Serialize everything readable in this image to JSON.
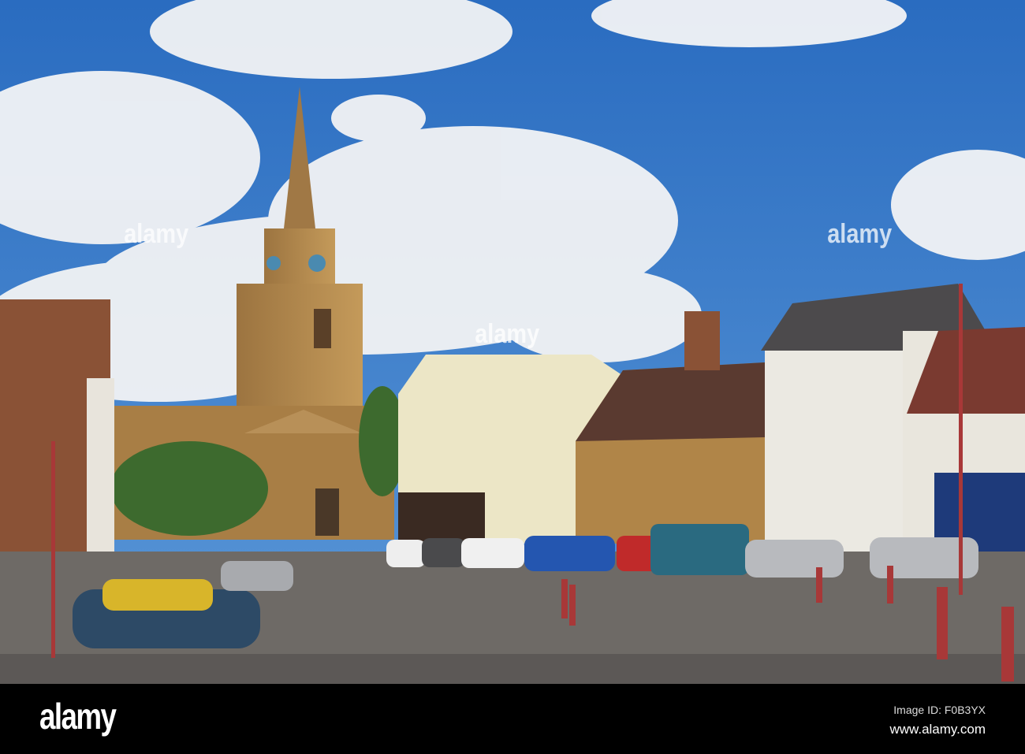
{
  "photo": {
    "subject": "town square with church spire"
  },
  "watermark": {
    "text": "alamy"
  },
  "footer": {
    "logo": "alamy",
    "image_id": "Image ID: F0B3YX",
    "website": "www.alamy.com"
  },
  "colors": {
    "sky": "#2f73c4",
    "stone": "#b0864a",
    "road": "#6e6a66",
    "footer": "#000000"
  }
}
